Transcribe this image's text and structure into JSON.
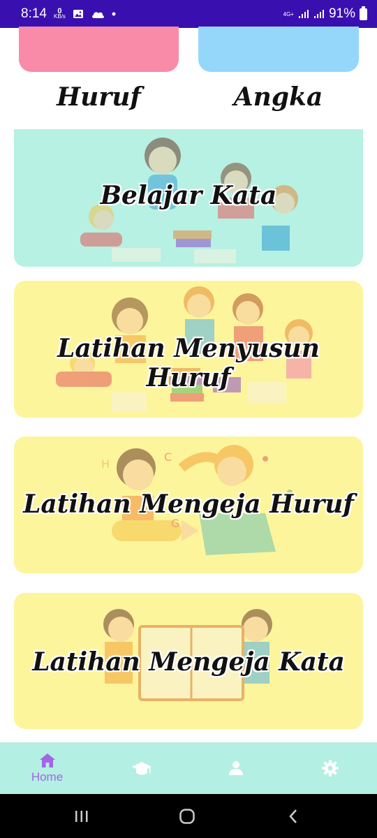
{
  "status_bar": {
    "time": "8:14",
    "kb_value": "0",
    "kb_unit": "KB/s",
    "network": "4G+",
    "battery": "91%"
  },
  "top_tiles": [
    {
      "label": "Huruf",
      "color": "#f98aa8"
    },
    {
      "label": "Angka",
      "color": "#95d7fb"
    }
  ],
  "cards": [
    {
      "title": "Belajar Kata",
      "color": "#b6f1e3"
    },
    {
      "title": "Latihan Menyusun Huruf",
      "color": "#fdf59c"
    },
    {
      "title": "Latihan Mengeja Huruf",
      "color": "#fdf59c"
    },
    {
      "title": "Latihan Mengeja Kata",
      "color": "#fdf59c"
    }
  ],
  "bottom_nav": {
    "items": [
      {
        "icon": "home-icon",
        "label": "Home",
        "active": true
      },
      {
        "icon": "graduation-cap-icon"
      },
      {
        "icon": "person-icon"
      },
      {
        "icon": "gear-icon"
      }
    ],
    "active_color": "#a066e6",
    "inactive_color": "#ffffff"
  }
}
